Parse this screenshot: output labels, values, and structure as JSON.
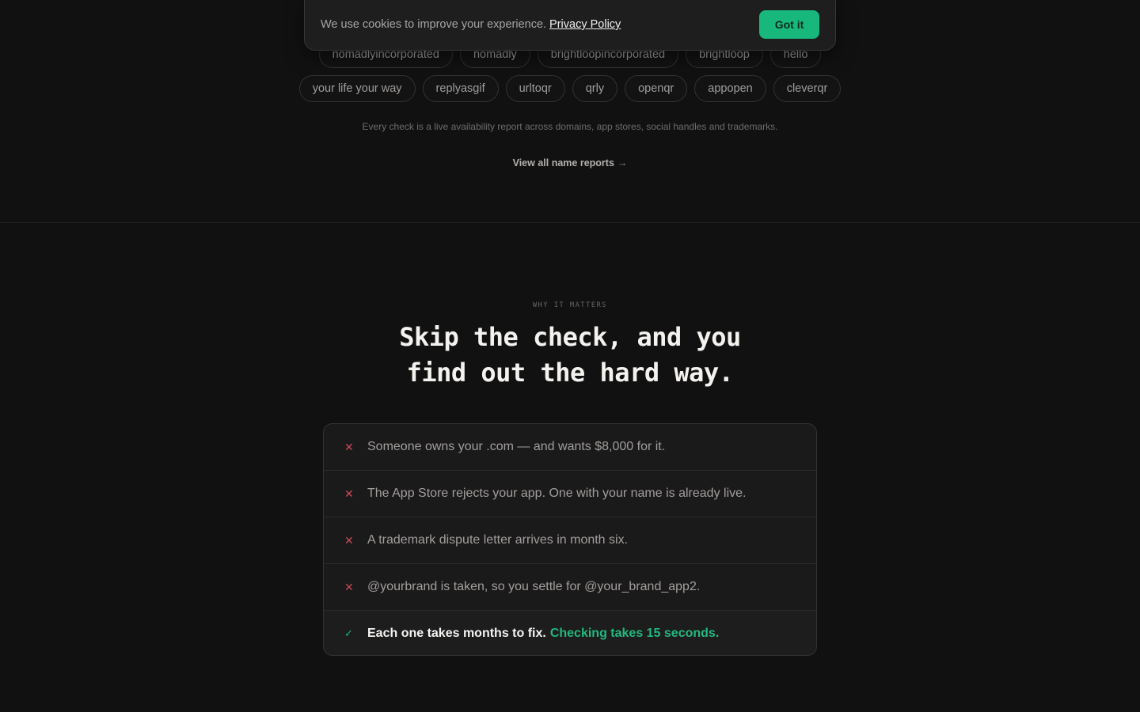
{
  "cookie": {
    "message": "We use cookies to improve your experience.",
    "link_label": "Privacy Policy",
    "button_label": "Got it"
  },
  "chips_row1": [
    "nomadlyincorporated",
    "nomadly",
    "brightloopincorporated",
    "brightloop",
    "hello"
  ],
  "chips_row2": [
    "your life your way",
    "replyasgif",
    "urltoqr",
    "qrly",
    "openqr",
    "appopen",
    "cleverqr"
  ],
  "caption": "Every check is a live availability report across domains, app stores, social handles and trademarks.",
  "view_all_label": "View all name reports",
  "view_all_arrow": "→",
  "why": {
    "eyebrow": "WHY IT MATTERS",
    "headline_line1": "Skip the check, and you",
    "headline_line2": "find out the hard way.",
    "risks": [
      "Someone owns your .com — and wants $8,000 for it.",
      "The App Store rejects your app. One with your name is already live.",
      "A trademark dispute letter arrives in month six.",
      "@yourbrand is taken, so you settle for @your_brand_app2."
    ],
    "risk_icon": "x-icon",
    "final_icon": "check-icon",
    "final_text": "Each one takes months to fix.",
    "final_highlight": "Checking takes 15 seconds.",
    "accent_color": "#22b87e",
    "danger_color": "#c9495a"
  }
}
